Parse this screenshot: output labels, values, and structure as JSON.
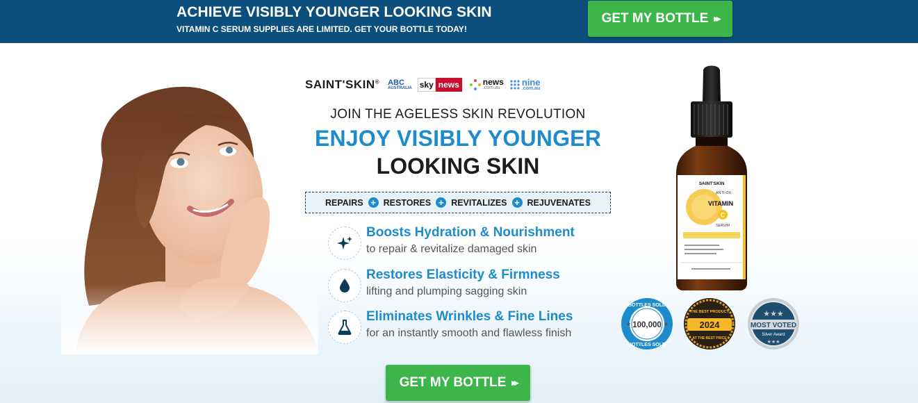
{
  "top_bar": {
    "headline": "ACHIEVE VISIBLY YOUNGER LOOKING SKIN",
    "subline": "VITAMIN C SERUM SUPPLIES ARE LIMITED. GET YOUR BOTTLE TODAY!",
    "cta_label": "GET MY BOTTLE",
    "cta_arrows": "▸▸"
  },
  "logos": {
    "brand": "SAINT'SKIN",
    "brand_mark": "®",
    "abc": "ABC",
    "abc_sub": "AUSTRALIA",
    "sky": "sky",
    "sky_news": "news",
    "newscomau": "news",
    "newscomau_sub": ".com.au",
    "nine": "nine",
    "nine_sub": ".com.au"
  },
  "hero": {
    "kicker": "JOIN THE AGELESS SKIN REVOLUTION",
    "headline_blue": "ENJOY VISIBLY YOUNGER",
    "headline_dark": "LOOKING SKIN"
  },
  "benefits": [
    "REPAIRS",
    "RESTORES",
    "REVITALIZES",
    "REJUVENATES"
  ],
  "features": [
    {
      "icon": "sparkle-icon",
      "title": "Boosts Hydration & Nourishment",
      "subtitle": "to repair & revitalize damaged skin"
    },
    {
      "icon": "droplet-icon",
      "title": "Restores Elasticity & Firmness",
      "subtitle": "lifting and plumping sagging skin"
    },
    {
      "icon": "flask-icon",
      "title": "Eliminates Wrinkles & Fine Lines",
      "subtitle": "for an instantly smooth and flawless finish"
    }
  ],
  "bottle": {
    "brand": "SAINT'SKIN",
    "line1": "ANTI-OX",
    "line2": "VITAMIN",
    "letter": "C",
    "line3": "SERUM"
  },
  "badges": {
    "sold_top": "BOTTLES SOLD",
    "sold_count": "100,000",
    "sold_bottom": "BOTTLES SOLD",
    "best_top": "THE BEST PRODUCT",
    "best_year": "2024",
    "best_bottom": "AT THE BEST PRICE",
    "voted_title": "MOST VOTED",
    "voted_sub": "Silver Award"
  },
  "bottom_cta": {
    "label": "GET MY BOTTLE",
    "arrows": "▸▸"
  },
  "colors": {
    "navy": "#0d4f7c",
    "green": "#3cb54a",
    "blue": "#1e8ccc"
  }
}
